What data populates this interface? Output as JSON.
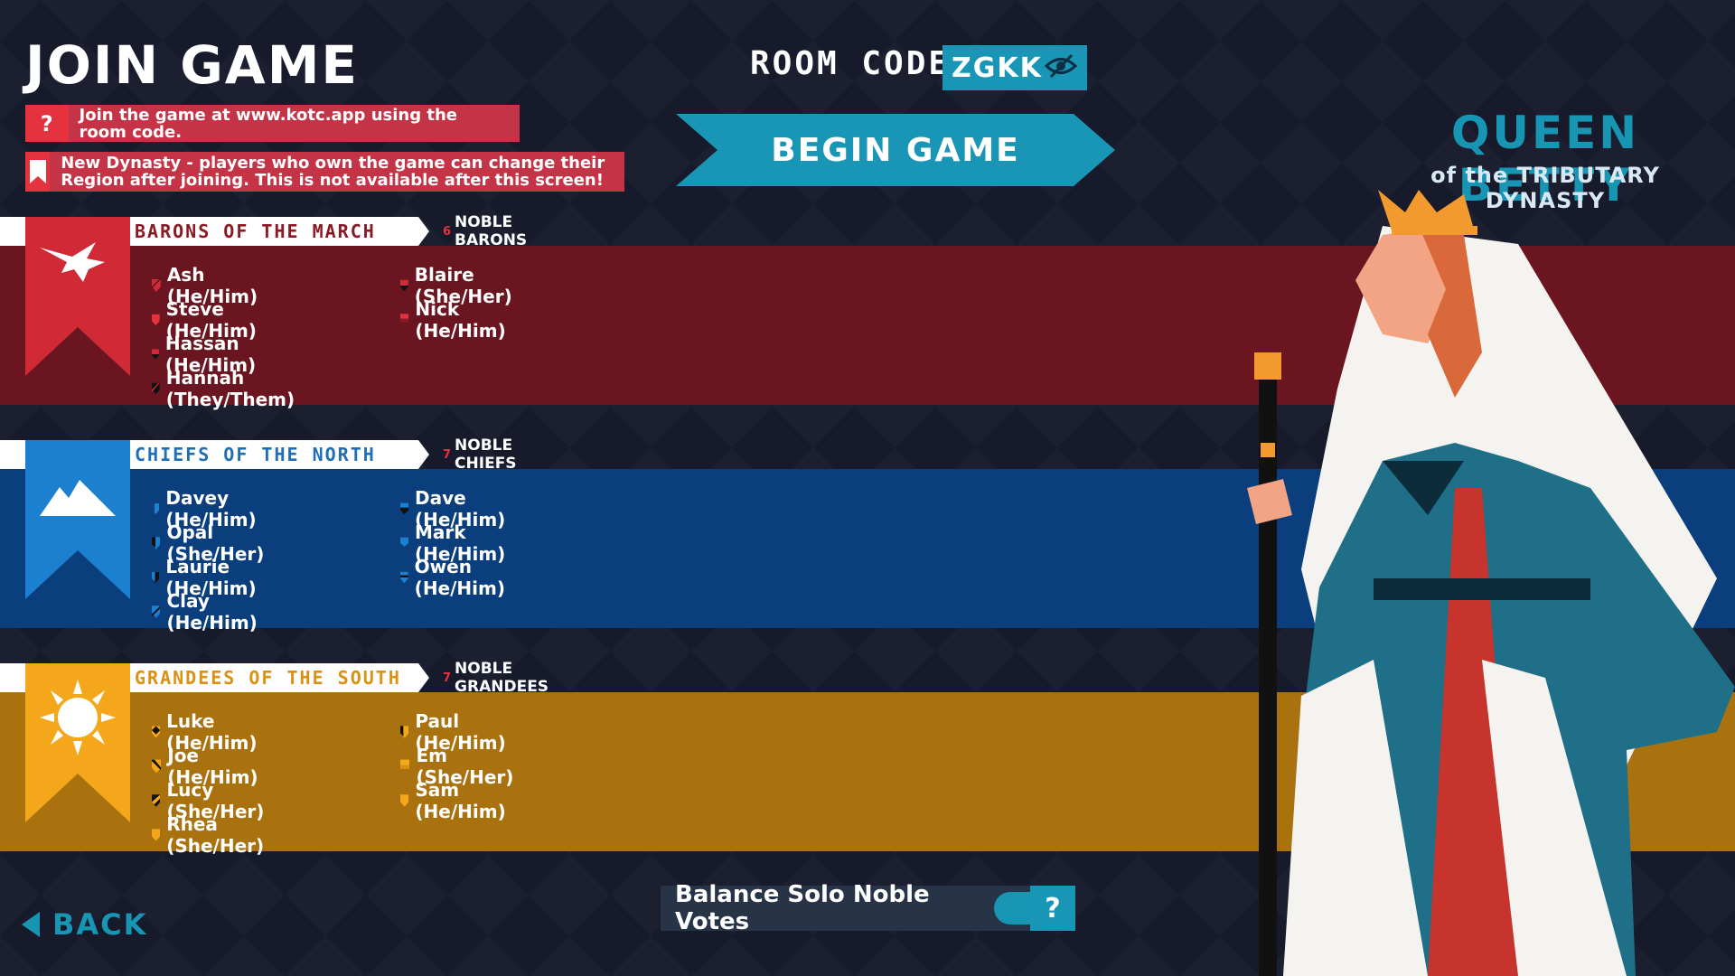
{
  "header": {
    "title": "Join Game",
    "room_label": "ROOM CODE:",
    "room_code": "ZGKK",
    "begin_label": "BEGIN GAME"
  },
  "info": [
    {
      "icon": "?",
      "text": "Join the game at www.kotc.app using the room code."
    },
    {
      "icon": "bookmark-icon",
      "text": "New Dynasty - players who own the game can change their Region after joining. This is not available after this screen!"
    }
  ],
  "queen": {
    "name": "QUEEN BETTY",
    "subtitle": "of the TRIBUTARY DYNASTY"
  },
  "regions": [
    {
      "name": "Barons of the March",
      "count": "6",
      "count_label": "NOBLE BARONS",
      "color": "#6b1520",
      "banner_color": "#d02a37",
      "header_text_color": "#8a1a24",
      "left_players": [
        "Ash (He/Him)",
        "Steve (He/Him)",
        "Hassan (He/Him)",
        "Hannah (They/Them)"
      ],
      "right_players": [
        "Blaire (She/Her)",
        "Nick (He/Him)"
      ]
    },
    {
      "name": "Chiefs of the North",
      "count": "7",
      "count_label": "NOBLE CHIEFS",
      "color": "#0b3e7c",
      "banner_color": "#1b80cf",
      "header_text_color": "#1f6fb8",
      "left_players": [
        "Davey (He/Him)",
        "Opal (She/Her)",
        "Laurie (He/Him)",
        "Clay (He/Him)"
      ],
      "right_players": [
        "Dave (He/Him)",
        "Mark (He/Him)",
        "Owen (He/Him)"
      ]
    },
    {
      "name": "Grandees of the South",
      "count": "7",
      "count_label": "NOBLE GRANDEES",
      "color": "#a9720f",
      "banner_color": "#f5a71c",
      "header_text_color": "#d99214",
      "left_players": [
        "Luke (He/Him)",
        "Joe (He/Him)",
        "Lucy (She/Her)",
        "Rhea (She/Her)"
      ],
      "right_players": [
        "Paul (He/Him)",
        "Em (She/Her)",
        "Sam (He/Him)"
      ]
    }
  ],
  "footer": {
    "back_label": "BACK",
    "toggle_label": "Balance Solo Noble Votes",
    "toggle_on": true,
    "help_label": "?"
  }
}
